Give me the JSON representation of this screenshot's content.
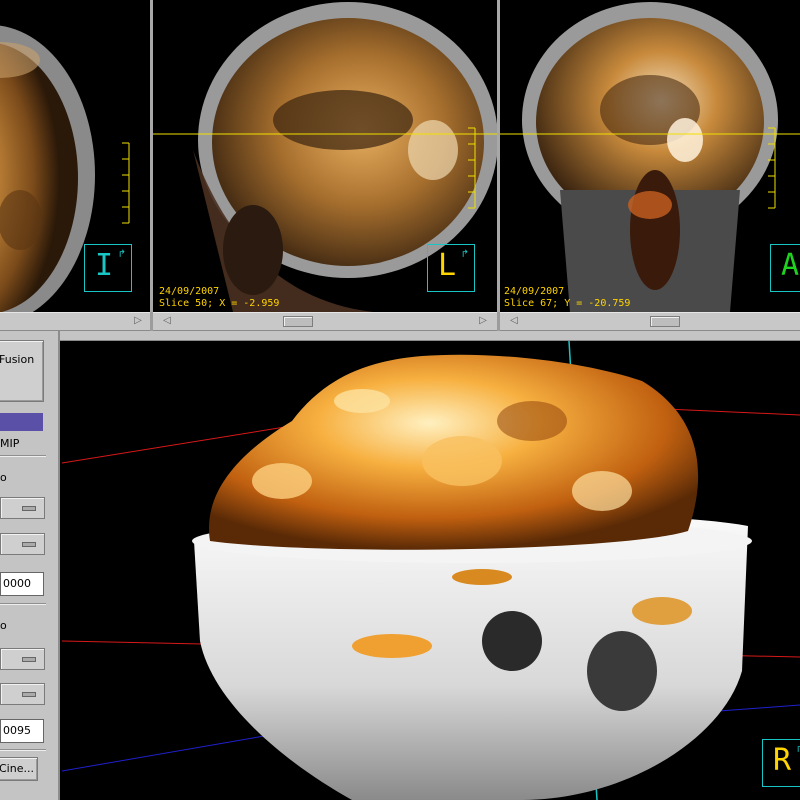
{
  "viewports": {
    "axial": {
      "orientation_letter": "I",
      "letter_color": "#19c6c6"
    },
    "sagittal": {
      "date": "24/09/2007",
      "slice_info": "Slice 50; X = -2.959",
      "orientation_letter": "L",
      "letter_color": "#ffd400"
    },
    "coronal": {
      "date": "24/09/2007",
      "slice_info": "Slice 67; Y = -20.759",
      "orientation_letter": "A",
      "letter_color": "#1fd21f"
    },
    "render3d": {
      "orientation_letter": "R",
      "letter_color": "#ffd400"
    }
  },
  "panel": {
    "fusion_label": "Fusion",
    "mip_label": "MIP",
    "option_a": "o",
    "value_a": "0000",
    "option_b": "o",
    "value_b": "0095",
    "cine_button": "Cine...",
    "highlight_color": "#5a50a8"
  },
  "colors": {
    "crosshair_yellow": "#f0e000",
    "axis_red": "#d81818",
    "axis_cyan": "#19c6c6",
    "axis_blue": "#2020d0"
  }
}
